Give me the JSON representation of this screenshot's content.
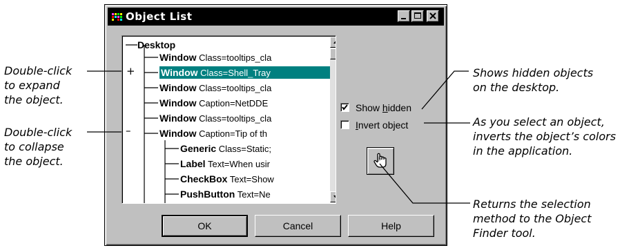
{
  "window": {
    "title": "Object List",
    "controls": [
      "minimize",
      "maximize",
      "close"
    ]
  },
  "tree": {
    "root": "Desktop",
    "nodes": [
      {
        "type": "Window",
        "detail": "Class=tooltips_cla",
        "selected": false
      },
      {
        "type": "Window",
        "detail": "Class=Shell_Tray",
        "selected": true
      },
      {
        "type": "Window",
        "detail": "Class=tooltips_cla",
        "selected": false
      },
      {
        "type": "Window",
        "detail": "Caption=NetDDE",
        "selected": false
      },
      {
        "type": "Window",
        "detail": "Class=tooltips_cla",
        "selected": false
      },
      {
        "type": "Window",
        "detail": "Caption=Tip of th",
        "selected": false
      },
      {
        "type": "Generic",
        "detail": "Class=Static;",
        "selected": false
      },
      {
        "type": "Label",
        "detail": "Text=When usir",
        "selected": false
      },
      {
        "type": "CheckBox",
        "detail": "Text=Show",
        "selected": false
      },
      {
        "type": "PushButton",
        "detail": "Text=Ne",
        "selected": false
      }
    ],
    "expander_plus": "+",
    "expander_minus": "–"
  },
  "options": {
    "show_hidden": {
      "pre": "Show ",
      "accel": "h",
      "post": "idden",
      "checked": true
    },
    "invert_object": {
      "pre": "",
      "accel": "I",
      "post": "nvert object",
      "checked": false
    }
  },
  "finder_tool": {
    "icon": "pointing-hand-icon"
  },
  "buttons": {
    "ok": "OK",
    "cancel": "Cancel",
    "help": "Help"
  },
  "callouts": {
    "expand": [
      "Double-click",
      "to expand",
      "the object."
    ],
    "collapse": [
      "Double-click",
      "to collapse",
      "the object."
    ],
    "show_hidden": [
      "Shows hidden objects",
      "on the desktop."
    ],
    "invert": [
      "As you select an object,",
      "inverts the object’s colors",
      "in the application."
    ],
    "finder": [
      "Returns the selection",
      "method to the Object",
      "Finder tool."
    ]
  }
}
